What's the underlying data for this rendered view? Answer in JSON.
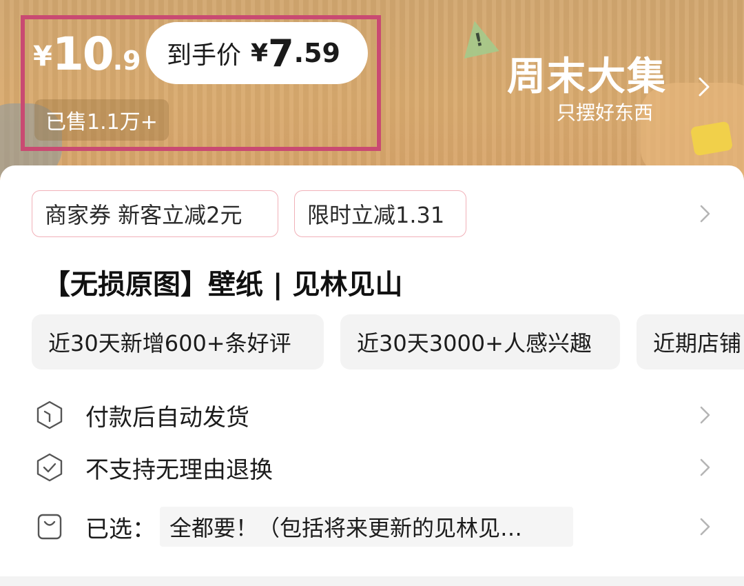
{
  "banner": {
    "original_price": {
      "currency": "¥",
      "integer": "10",
      "decimal": ".9"
    },
    "final_price": {
      "label": "到手价",
      "currency": "¥",
      "integer": "7",
      "decimal": ".59"
    },
    "sold": "已售1.1万+",
    "campaign_title": "周末大集",
    "campaign_subtitle": "只摆好东西",
    "colors": {
      "background": "#d9aa6e",
      "highlight_border": "#c94a72"
    }
  },
  "coupons": [
    {
      "label": "商家券 新客立减2元"
    },
    {
      "label": "限时立减1.31"
    }
  ],
  "product": {
    "title": "【无损原图】壁纸 | 见林见山"
  },
  "tags": [
    {
      "label": "近30天新增600+条好评"
    },
    {
      "label": "近30天3000+人感兴趣"
    },
    {
      "label": "近期店铺"
    }
  ],
  "info_rows": {
    "shipping": {
      "icon": "package-icon",
      "label": "付款后自动发货"
    },
    "returns": {
      "icon": "shield-check-icon",
      "label": "不支持无理由退换"
    },
    "selected": {
      "icon": "bag-icon",
      "label": "已选：",
      "value": "全都要！（包括将来更新的见林见…"
    }
  }
}
